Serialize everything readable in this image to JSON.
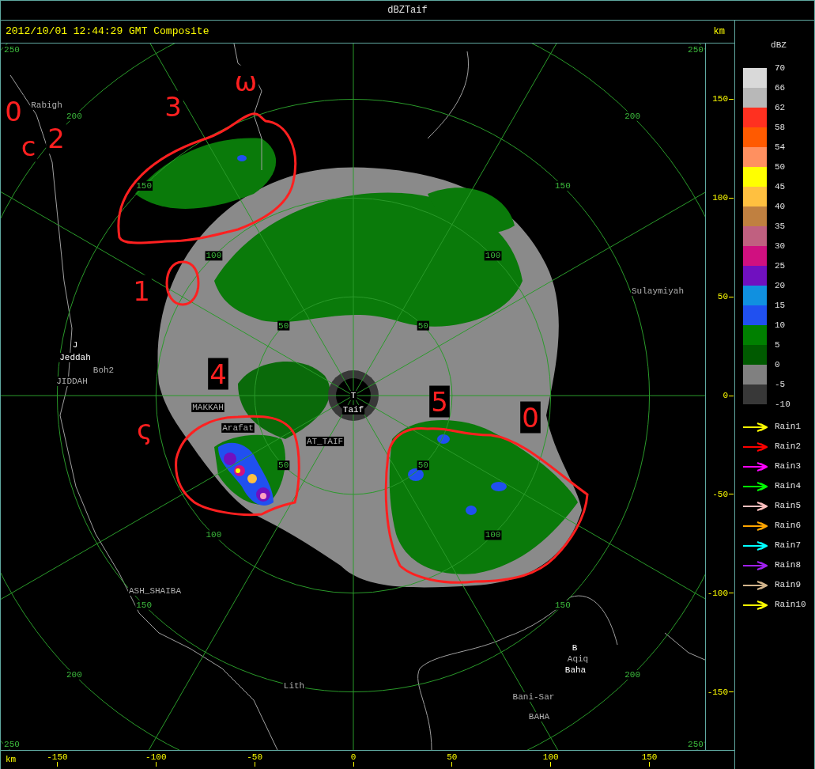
{
  "window": {
    "title": "dBZTaif"
  },
  "header": {
    "timestamp": "2012/10/01 12:44:29 GMT Composite",
    "unit": "km"
  },
  "map": {
    "ring_labels": [
      [
        "50",
        "100",
        "150",
        "200",
        "250"
      ],
      [
        "50",
        "100",
        "150",
        "200",
        "250"
      ],
      [
        "50",
        "100",
        "150",
        "200",
        "250"
      ],
      [
        "50",
        "100",
        "150",
        "200",
        "250"
      ]
    ],
    "places": [
      {
        "name": "Rabigh",
        "kind": "town"
      },
      {
        "name": "J",
        "kind": "site"
      },
      {
        "name": "Jeddah",
        "kind": "site"
      },
      {
        "name": "Boh2",
        "kind": "town"
      },
      {
        "name": "JIDDAH",
        "kind": "town"
      },
      {
        "name": "MAKKAH",
        "kind": "town"
      },
      {
        "name": "Arafat",
        "kind": "town"
      },
      {
        "name": "AT_TAIF",
        "kind": "town"
      },
      {
        "name": "T",
        "kind": "site"
      },
      {
        "name": "Taif",
        "kind": "site"
      },
      {
        "name": "Sulaymiyah",
        "kind": "town"
      },
      {
        "name": "ASH_SHAIBA",
        "kind": "town"
      },
      {
        "name": "Lith",
        "kind": "town"
      },
      {
        "name": "B",
        "kind": "site"
      },
      {
        "name": "Aqiq",
        "kind": "town"
      },
      {
        "name": "Baha",
        "kind": "site"
      },
      {
        "name": "Bani-Sar",
        "kind": "town"
      },
      {
        "name": "BAHA",
        "kind": "town"
      }
    ],
    "annotations": [
      "0",
      "2",
      "c",
      "3",
      "ω",
      "1",
      "4",
      "ς",
      "5",
      "0"
    ]
  },
  "y_axis": {
    "ticks": [
      "150",
      "100",
      "50",
      "0",
      "-50",
      "-100",
      "-150"
    ]
  },
  "x_axis": {
    "unit": "km",
    "ticks": [
      "-150",
      "-100",
      "-50",
      "0",
      "50",
      "100",
      "150"
    ]
  },
  "legend": {
    "title": "dBZ",
    "bins": [
      {
        "label": "70",
        "color": "#d9d9d9"
      },
      {
        "label": "66",
        "color": "#b8b8b8"
      },
      {
        "label": "62",
        "color": "#ff3020"
      },
      {
        "label": "58",
        "color": "#ff5a00"
      },
      {
        "label": "54",
        "color": "#ff9060"
      },
      {
        "label": "50",
        "color": "#ffff00"
      },
      {
        "label": "45",
        "color": "#ffc040"
      },
      {
        "label": "40",
        "color": "#c08040"
      },
      {
        "label": "35",
        "color": "#c06080"
      },
      {
        "label": "30",
        "color": "#d01080"
      },
      {
        "label": "25",
        "color": "#7010c0"
      },
      {
        "label": "20",
        "color": "#1090e0"
      },
      {
        "label": "15",
        "color": "#2050f0"
      },
      {
        "label": "10",
        "color": "#008000"
      },
      {
        "label": "5",
        "color": "#005a00"
      },
      {
        "label": "0",
        "color": "#808080"
      },
      {
        "label": "-5",
        "color": "#383838"
      }
    ],
    "bottom_label": "-10",
    "tracks": [
      {
        "label": "Rain1",
        "color": "#ffff00"
      },
      {
        "label": "Rain2",
        "color": "#ff0000"
      },
      {
        "label": "Rain3",
        "color": "#ff00ff"
      },
      {
        "label": "Rain4",
        "color": "#00ff00"
      },
      {
        "label": "Rain5",
        "color": "#ffc0c0"
      },
      {
        "label": "Rain6",
        "color": "#ffa500"
      },
      {
        "label": "Rain7",
        "color": "#00ffff"
      },
      {
        "label": "Rain8",
        "color": "#a020f0"
      },
      {
        "label": "Rain9",
        "color": "#d2b48c"
      },
      {
        "label": "Rain10",
        "color": "#ffff00"
      }
    ]
  }
}
